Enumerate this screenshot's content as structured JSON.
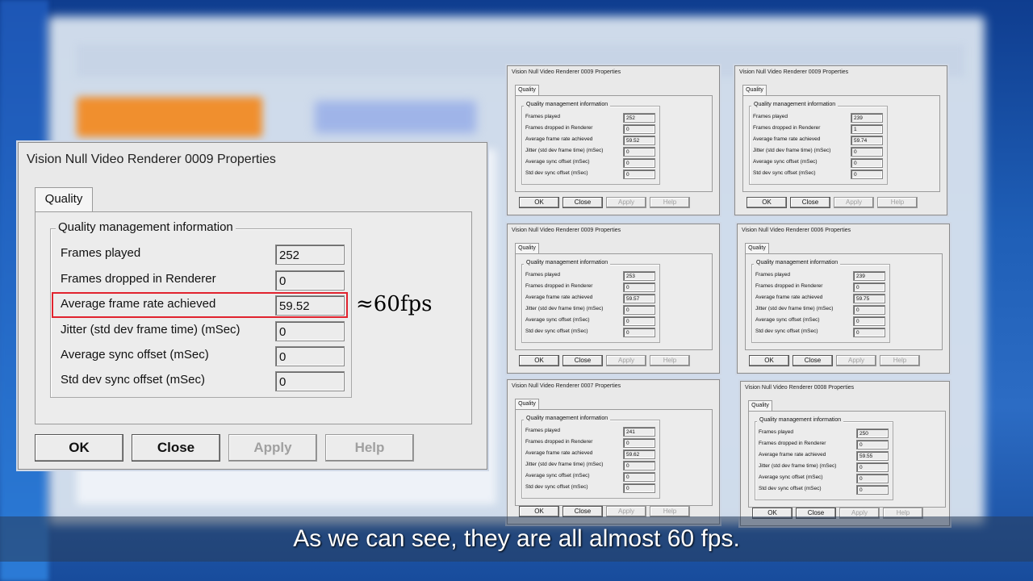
{
  "main_dialog": {
    "title": "Vision Null Video Renderer 0009 Properties",
    "tab": "Quality",
    "group": "Quality management information",
    "rows": [
      {
        "label": "Frames played",
        "value": "252"
      },
      {
        "label": "Frames dropped in Renderer",
        "value": "0"
      },
      {
        "label": "Average frame rate achieved",
        "value": "59.52"
      },
      {
        "label": "Jitter (std dev frame time) (mSec)",
        "value": "0"
      },
      {
        "label": "Average sync offset (mSec)",
        "value": "0"
      },
      {
        "label": "Std dev sync offset (mSec)",
        "value": "0"
      }
    ],
    "buttons": {
      "ok": "OK",
      "close": "Close",
      "apply": "Apply",
      "help": "Help"
    }
  },
  "annotation": "≈60fps",
  "small_dialogs": [
    {
      "title": "Vision Null Video Renderer 0009 Properties",
      "tab": "Quality",
      "group": "Quality management information",
      "rows": [
        {
          "label": "Frames played",
          "value": "252"
        },
        {
          "label": "Frames dropped in Renderer",
          "value": "0"
        },
        {
          "label": "Average frame rate achieved",
          "value": "59.52"
        },
        {
          "label": "Jitter (std dev frame time) (mSec)",
          "value": "0"
        },
        {
          "label": "Average sync offset (mSec)",
          "value": "0"
        },
        {
          "label": "Std dev sync offset (mSec)",
          "value": "0"
        }
      ],
      "buttons": {
        "ok": "OK",
        "close": "Close",
        "apply": "Apply",
        "help": "Help"
      }
    },
    {
      "title": "Vision Null Video Renderer 0009 Properties",
      "tab": "Quality",
      "group": "Quality management information",
      "rows": [
        {
          "label": "Frames played",
          "value": "239"
        },
        {
          "label": "Frames dropped in Renderer",
          "value": "1"
        },
        {
          "label": "Average frame rate achieved",
          "value": "59.74"
        },
        {
          "label": "Jitter (std dev frame time) (mSec)",
          "value": "0"
        },
        {
          "label": "Average sync offset (mSec)",
          "value": "0"
        },
        {
          "label": "Std dev sync offset (mSec)",
          "value": "0"
        }
      ],
      "buttons": {
        "ok": "OK",
        "close": "Close",
        "apply": "Apply",
        "help": "Help"
      }
    },
    {
      "title": "Vision Null Video Renderer 0009 Properties",
      "tab": "Quality",
      "group": "Quality management information",
      "rows": [
        {
          "label": "Frames played",
          "value": "253"
        },
        {
          "label": "Frames dropped in Renderer",
          "value": "0"
        },
        {
          "label": "Average frame rate achieved",
          "value": "59.57"
        },
        {
          "label": "Jitter (std dev frame time) (mSec)",
          "value": "0"
        },
        {
          "label": "Average sync offset (mSec)",
          "value": "0"
        },
        {
          "label": "Std dev sync offset (mSec)",
          "value": "0"
        }
      ],
      "buttons": {
        "ok": "OK",
        "close": "Close",
        "apply": "Apply",
        "help": "Help"
      }
    },
    {
      "title": "Vision Null Video Renderer 0006 Properties",
      "tab": "Quality",
      "group": "Quality management information",
      "rows": [
        {
          "label": "Frames played",
          "value": "239"
        },
        {
          "label": "Frames dropped in Renderer",
          "value": "0"
        },
        {
          "label": "Average frame rate achieved",
          "value": "59.75"
        },
        {
          "label": "Jitter (std dev frame time) (mSec)",
          "value": "0"
        },
        {
          "label": "Average sync offset (mSec)",
          "value": "0"
        },
        {
          "label": "Std dev sync offset (mSec)",
          "value": "0"
        }
      ],
      "buttons": {
        "ok": "OK",
        "close": "Close",
        "apply": "Apply",
        "help": "Help"
      }
    },
    {
      "title": "Vision Null Video Renderer 0007 Properties",
      "tab": "Quality",
      "group": "Quality management information",
      "rows": [
        {
          "label": "Frames played",
          "value": "241"
        },
        {
          "label": "Frames dropped in Renderer",
          "value": "0"
        },
        {
          "label": "Average frame rate achieved",
          "value": "59.62"
        },
        {
          "label": "Jitter (std dev frame time) (mSec)",
          "value": "0"
        },
        {
          "label": "Average sync offset (mSec)",
          "value": "0"
        },
        {
          "label": "Std dev sync offset (mSec)",
          "value": "0"
        }
      ],
      "buttons": {
        "ok": "OK",
        "close": "Close",
        "apply": "Apply",
        "help": "Help"
      }
    },
    {
      "title": "Vision Null Video Renderer 0008 Properties",
      "tab": "Quality",
      "group": "Quality management information",
      "rows": [
        {
          "label": "Frames played",
          "value": "250"
        },
        {
          "label": "Frames dropped in Renderer",
          "value": "0"
        },
        {
          "label": "Average frame rate achieved",
          "value": "59.55"
        },
        {
          "label": "Jitter (std dev frame time) (mSec)",
          "value": "0"
        },
        {
          "label": "Average sync offset (mSec)",
          "value": "0"
        },
        {
          "label": "Std dev sync offset (mSec)",
          "value": "0"
        }
      ],
      "buttons": {
        "ok": "OK",
        "close": "Close",
        "apply": "Apply",
        "help": "Help"
      }
    }
  ],
  "subtitle": "As we can see, they are all almost 60 fps."
}
